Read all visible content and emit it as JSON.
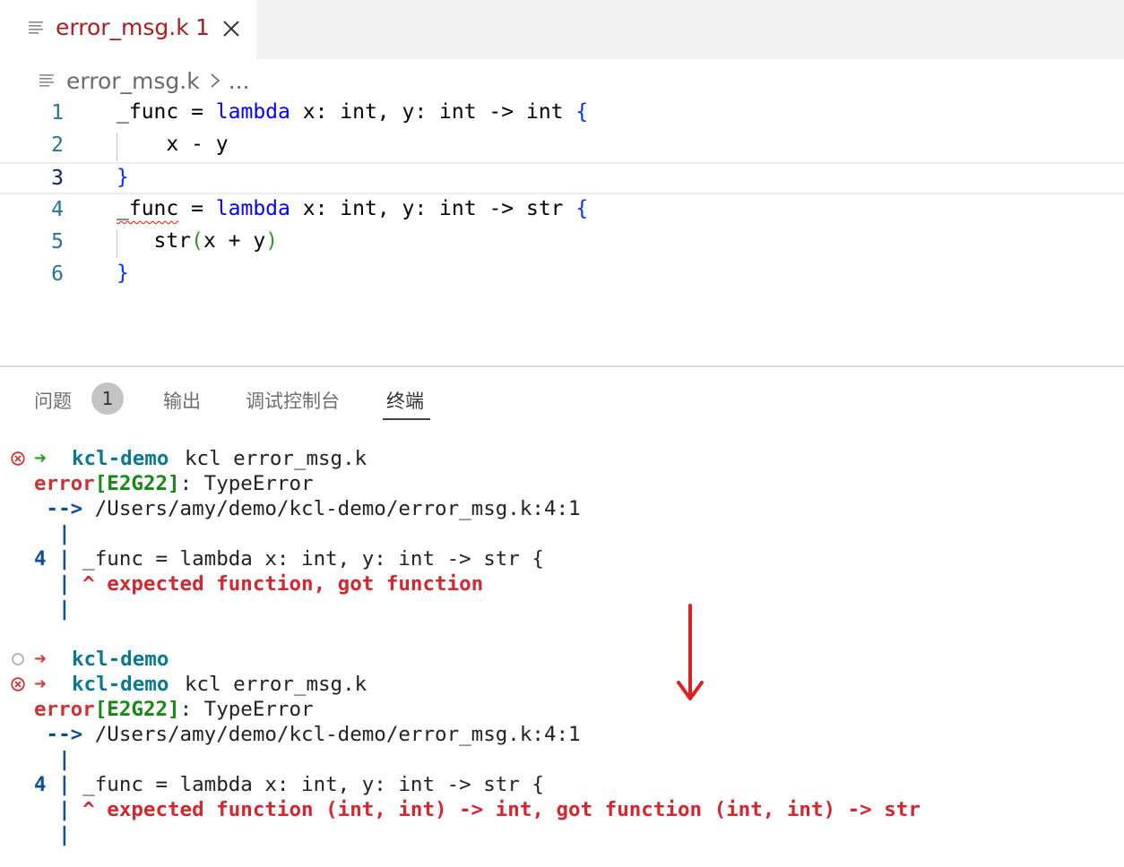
{
  "tab": {
    "file_name": "error_msg.k",
    "problem_count": "1",
    "icon": "file-lines-icon",
    "close_icon": "close-icon"
  },
  "breadcrumb": {
    "file": "error_msg.k",
    "more": "..."
  },
  "editor": {
    "lines": [
      {
        "num": "1"
      },
      {
        "num": "2"
      },
      {
        "num": "3"
      },
      {
        "num": "4"
      },
      {
        "num": "5"
      },
      {
        "num": "6"
      }
    ],
    "tokens": {
      "l1_a": "_func = ",
      "l1_kw": "lambda",
      "l1_b": " x: int, y: int -> int ",
      "l1_br": "{",
      "l2": "    x - y",
      "l3_br": "}",
      "l4_sq": "_func",
      "l4_a": " = ",
      "l4_kw": "lambda",
      "l4_b": " x: int, y: int -> str ",
      "l4_br": "{",
      "l5_a": "   str",
      "l5_p1": "(",
      "l5_b": "x + y",
      "l5_p2": ")",
      "l6_br": "}"
    }
  },
  "panel": {
    "tabs": {
      "problems": "问题",
      "output": "输出",
      "debug_console": "调试控制台",
      "terminal": "终端"
    },
    "problems_badge": "1"
  },
  "terminal": {
    "block1": {
      "prompt_arrow": "➜",
      "dir": "kcl-demo",
      "cmd": "kcl error_msg.k",
      "err_word": "error",
      "err_code": "[E2G22]",
      "err_type": ": TypeError",
      "loc_arrow": " -->",
      "loc": " /Users/amy/demo/kcl-demo/error_msg.k:4:1",
      "pipe": "  |",
      "src_num": "4",
      "src_pipe": " |",
      "src": " _func = lambda x: int, y: int -> str {",
      "caret_pipe": "  |",
      "caret_msg": " ^ expected function, got function"
    },
    "block2": {
      "line_a_arrow": "➜",
      "line_a_dir": "kcl-demo",
      "prompt_arrow": "➜",
      "dir": "kcl-demo",
      "cmd": "kcl error_msg.k",
      "err_word": "error",
      "err_code": "[E2G22]",
      "err_type": ": TypeError",
      "loc_arrow": " -->",
      "loc": " /Users/amy/demo/kcl-demo/error_msg.k:4:1",
      "pipe": "  |",
      "src_num": "4",
      "src_pipe": " |",
      "src": " _func = lambda x: int, y: int -> str {",
      "caret_pipe": "  |",
      "caret_msg": " ^ expected function (int, int) -> int, got function (int, int) -> str"
    }
  },
  "colors": {
    "error_red": "#b01c1c",
    "keyword_blue": "#0000ff",
    "terminal_dir": "#0a7a92",
    "annotation_arrow": "#e02020"
  }
}
